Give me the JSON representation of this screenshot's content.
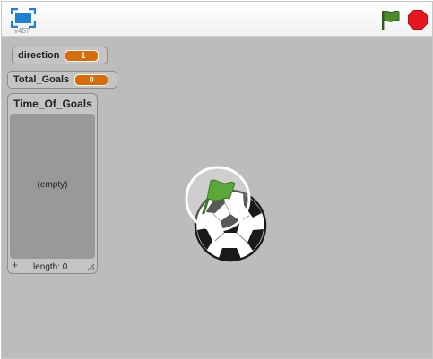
{
  "player": {
    "version": "v457",
    "icons": {
      "fullscreen": "fullscreen-icon",
      "green_flag": "green-flag-icon",
      "stop": "stop-sign-icon"
    },
    "colors": {
      "stage_background": "#bcbcbc",
      "green_flag": "#4b8b2c",
      "stop": "#e6171e",
      "monitor_value": "#d76c08",
      "fullscreen_icon": "#1f7fd1"
    }
  },
  "monitors": {
    "direction": {
      "name": "direction",
      "value": "-1"
    },
    "total_goals": {
      "name": "Total_Goals",
      "value": "0"
    }
  },
  "list": {
    "title": "Time_Of_Goals",
    "empty_text": "(empty)",
    "add_symbol": "+",
    "length_text": "length: 0"
  },
  "stage": {
    "sprite_name": "soccer-ball",
    "overlay": "green-flag-icon"
  }
}
